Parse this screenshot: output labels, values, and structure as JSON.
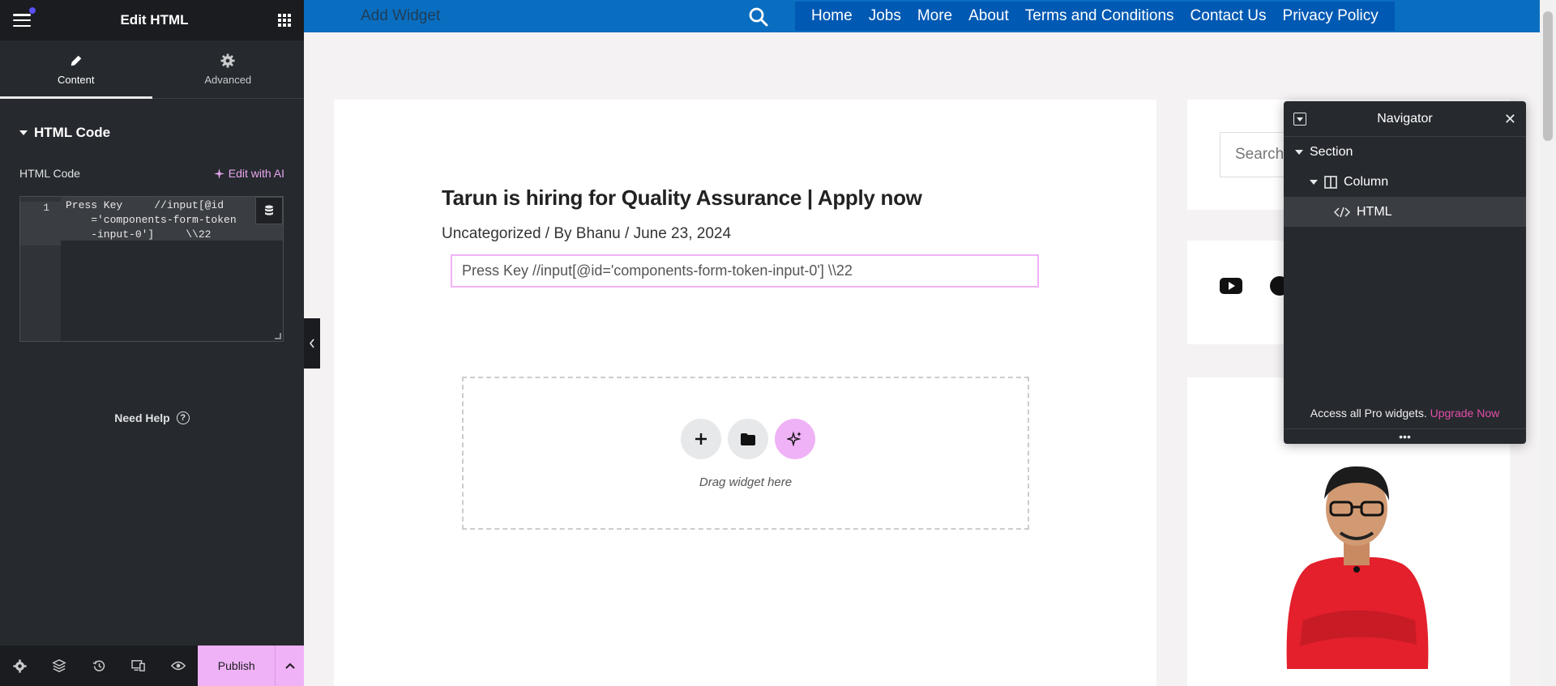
{
  "panel": {
    "title": "Edit HTML",
    "tabs": [
      {
        "label": "Content",
        "icon": "pencil-icon"
      },
      {
        "label": "Advanced",
        "icon": "gear-icon"
      }
    ],
    "section_title": "HTML Code",
    "field_label": "HTML Code",
    "edit_ai_label": "Edit with AI",
    "code": {
      "line_number": "1",
      "text": "Press Key     //input[@id\n    ='components-form-token\n    -input-0']     \\\\22"
    },
    "need_help": "Need Help",
    "footer": {
      "icons": [
        "settings-icon",
        "layers-icon",
        "history-icon",
        "responsive-icon",
        "preview-eye-icon"
      ],
      "publish_label": "Publish"
    }
  },
  "topbar": {
    "add_widget": "Add Widget",
    "menu": [
      "Home",
      "Jobs",
      "More",
      "About",
      "Terms and Conditions",
      "Contact Us",
      "Privacy Policy"
    ],
    "colors": {
      "bar": "#0a6ec0",
      "menu": "#0059b3"
    }
  },
  "post": {
    "title": "Tarun is hiring for Quality Assurance | Apply now",
    "meta": "Uncategorized / By Bhanu / June 23, 2024",
    "html_output": "Press Key //input[@id='components-form-token-input-0'] \\\\22",
    "drag_text": "Drag widget here"
  },
  "sidebar": {
    "search_placeholder": "Search"
  },
  "navigator": {
    "title": "Navigator",
    "items": [
      {
        "label": "Section",
        "level": 0,
        "expanded": true
      },
      {
        "label": "Column",
        "level": 1,
        "expanded": true
      },
      {
        "label": "HTML",
        "level": 2,
        "selected": true
      }
    ],
    "pro_text": "Access all Pro widgets.",
    "upgrade_label": "Upgrade Now",
    "dots": "•••"
  },
  "colors": {
    "accent_pink": "#f0b2f7",
    "upgrade_pink": "#e34da9",
    "panel_bg": "#26292e"
  }
}
